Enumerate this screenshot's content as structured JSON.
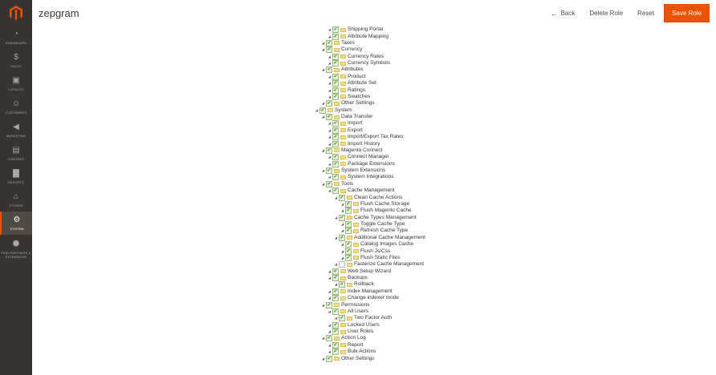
{
  "header": {
    "store_name": "zepgram",
    "back_label": "Back",
    "delete_label": "Delete Role",
    "reset_label": "Reset",
    "save_label": "Save Role"
  },
  "sidebar": {
    "logo_icon": "magento-logo-icon",
    "items": [
      {
        "label": "DASHBOARD",
        "icon": "dashboard-icon"
      },
      {
        "label": "SALES",
        "icon": "dollar-icon"
      },
      {
        "label": "CATALOG",
        "icon": "cube-icon"
      },
      {
        "label": "CUSTOMERS",
        "icon": "person-icon"
      },
      {
        "label": "MARKETING",
        "icon": "megaphone-icon"
      },
      {
        "label": "CONTENT",
        "icon": "content-icon"
      },
      {
        "label": "REPORTS",
        "icon": "bar-chart-icon"
      },
      {
        "label": "STORES",
        "icon": "store-icon"
      },
      {
        "label": "SYSTEM",
        "icon": "gear-icon"
      },
      {
        "label": "FIND PARTNERS & EXTENSIONS",
        "icon": "extensions-icon"
      }
    ],
    "active_item": "SYSTEM"
  },
  "colors": {
    "sidebar_bg": "#373330",
    "accent": "#eb5202",
    "checkbox_green": "#2e8a1f",
    "folder": "#f1dd8a"
  },
  "tree": {
    "rows": [
      {
        "label": "Shipping Portal",
        "level": 2,
        "checked": true
      },
      {
        "label": "Attribute Mapping",
        "level": 2,
        "checked": true
      },
      {
        "label": "Taxes",
        "level": 1,
        "checked": true
      },
      {
        "label": "Currency",
        "level": 1,
        "checked": true
      },
      {
        "label": "Currency Rates",
        "level": 2,
        "checked": true
      },
      {
        "label": "Currency Symbols",
        "level": 2,
        "checked": true
      },
      {
        "label": "Attributes",
        "level": 1,
        "checked": true
      },
      {
        "label": "Product",
        "level": 2,
        "checked": true
      },
      {
        "label": "Attribute Set",
        "level": 2,
        "checked": true
      },
      {
        "label": "Ratings",
        "level": 2,
        "checked": true
      },
      {
        "label": "Swatches",
        "level": 2,
        "checked": true
      },
      {
        "label": "Other Settings",
        "level": 1,
        "checked": true
      },
      {
        "label": "System",
        "level": 0,
        "checked": true
      },
      {
        "label": "Data Transfer",
        "level": 1,
        "checked": true
      },
      {
        "label": "Import",
        "level": 2,
        "checked": true
      },
      {
        "label": "Export",
        "level": 2,
        "checked": true
      },
      {
        "label": "Import/Export Tax Rates",
        "level": 2,
        "checked": true
      },
      {
        "label": "Import History",
        "level": 2,
        "checked": true
      },
      {
        "label": "Magento Connect",
        "level": 1,
        "checked": true
      },
      {
        "label": "Connect Manager",
        "level": 2,
        "checked": true
      },
      {
        "label": "Package Extensions",
        "level": 2,
        "checked": true
      },
      {
        "label": "System Extensions",
        "level": 1,
        "checked": true
      },
      {
        "label": "System Integrations",
        "level": 2,
        "checked": true
      },
      {
        "label": "Tools",
        "level": 1,
        "checked": true
      },
      {
        "label": "Cache Management",
        "level": 2,
        "checked": true
      },
      {
        "label": "Clean Cache Actions",
        "level": 3,
        "checked": true
      },
      {
        "label": "Flush Cache Storage",
        "level": 4,
        "checked": true
      },
      {
        "label": "Flush Magento Cache",
        "level": 4,
        "checked": true
      },
      {
        "label": "Cache Types Management",
        "level": 3,
        "checked": true
      },
      {
        "label": "Toggle Cache Type",
        "level": 4,
        "checked": true
      },
      {
        "label": "Refresh Cache Type",
        "level": 4,
        "checked": true
      },
      {
        "label": "Additional Cache Management",
        "level": 3,
        "checked": true
      },
      {
        "label": "Catalog Images Cache",
        "level": 4,
        "checked": true
      },
      {
        "label": "Flush Js/Css",
        "level": 4,
        "checked": true
      },
      {
        "label": "Flush Static Files",
        "level": 4,
        "checked": true
      },
      {
        "label": "Fasterize Cache Management",
        "level": 3,
        "checked": false
      },
      {
        "label": "Web Setup Wizard",
        "level": 2,
        "checked": true
      },
      {
        "label": "Backups",
        "level": 2,
        "checked": true
      },
      {
        "label": "Rollback",
        "level": 3,
        "checked": true
      },
      {
        "label": "Index Management",
        "level": 2,
        "checked": true
      },
      {
        "label": "Change indexer mode",
        "level": 2,
        "checked": true
      },
      {
        "label": "Permissions",
        "level": 1,
        "checked": true
      },
      {
        "label": "All Users",
        "level": 2,
        "checked": true
      },
      {
        "label": "Two Factor Auth",
        "level": 3,
        "checked": true
      },
      {
        "label": "Locked Users",
        "level": 2,
        "checked": true
      },
      {
        "label": "User Roles",
        "level": 2,
        "checked": true
      },
      {
        "label": "Action Log",
        "level": 1,
        "checked": true
      },
      {
        "label": "Report",
        "level": 2,
        "checked": true
      },
      {
        "label": "Bulk Actions",
        "level": 2,
        "checked": true
      },
      {
        "label": "Other Settings",
        "level": 1,
        "checked": true
      }
    ]
  }
}
